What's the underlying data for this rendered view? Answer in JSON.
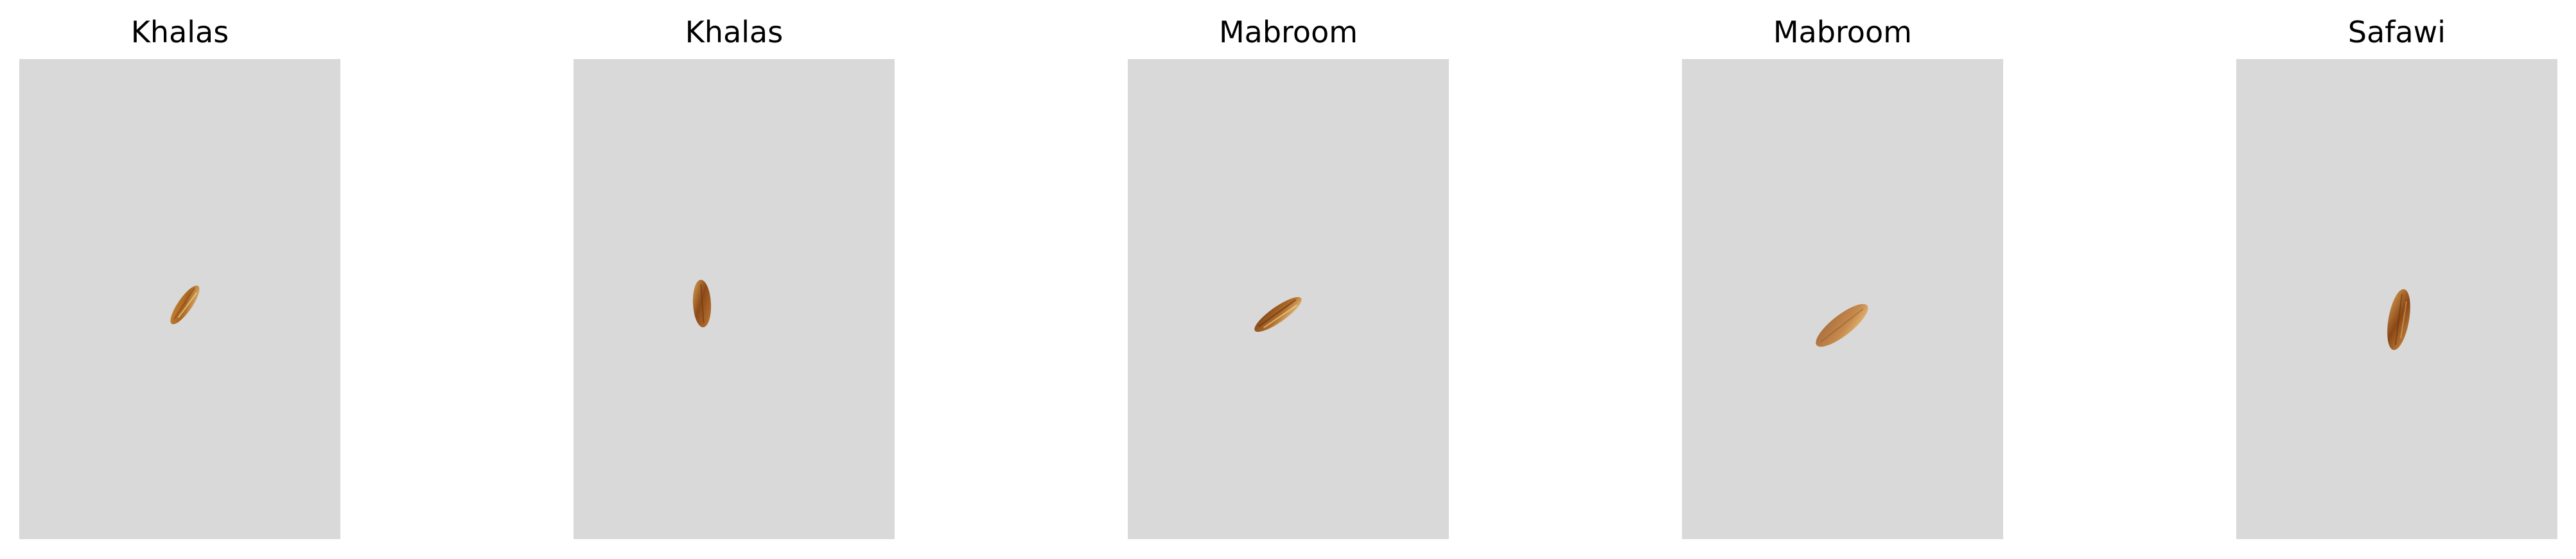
{
  "panels": [
    {
      "title": "Khalas",
      "subject": "date-seed-image"
    },
    {
      "title": "Khalas",
      "subject": "date-seed-image"
    },
    {
      "title": "Mabroom",
      "subject": "date-seed-image"
    },
    {
      "title": "Mabroom",
      "subject": "date-seed-image"
    },
    {
      "title": "Safawi",
      "subject": "date-seed-image"
    }
  ],
  "colors": {
    "background": "#d9d9d9",
    "seed_light": "#d9a75a",
    "seed_dark": "#7a3f14"
  }
}
